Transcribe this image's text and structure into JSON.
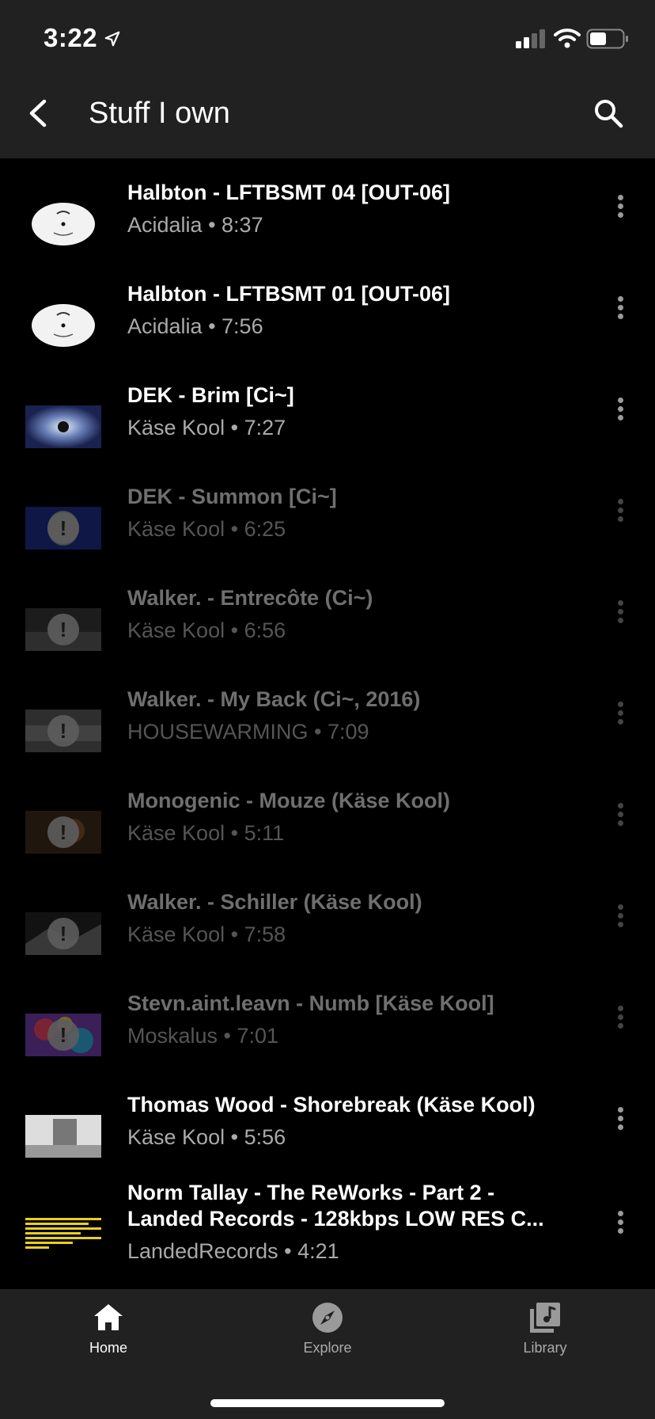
{
  "status": {
    "time": "3:22"
  },
  "header": {
    "title": "Stuff I own"
  },
  "items": [
    {
      "title": "Halbton - LFTBSMT 04 [OUT-06]",
      "channel": "Acidalia",
      "duration": "8:37",
      "unavailable": false
    },
    {
      "title": "Halbton - LFTBSMT 01 [OUT-06]",
      "channel": "Acidalia",
      "duration": "7:56",
      "unavailable": false
    },
    {
      "title": "DEK - Brim [Ci~]",
      "channel": "Käse Kool",
      "duration": "7:27",
      "unavailable": false
    },
    {
      "title": "DEK - Summon [Ci~]",
      "channel": "Käse Kool",
      "duration": "6:25",
      "unavailable": true
    },
    {
      "title": "Walker. - Entrecôte (Ci~)",
      "channel": "Käse Kool",
      "duration": "6:56",
      "unavailable": true
    },
    {
      "title": "Walker. - My Back (Ci~, 2016)",
      "channel": "HOUSEWARMING",
      "duration": "7:09",
      "unavailable": true
    },
    {
      "title": "Monogenic - Mouze (Käse Kool)",
      "channel": "Käse Kool",
      "duration": "5:11",
      "unavailable": true
    },
    {
      "title": "Walker. - Schiller (Käse Kool)",
      "channel": "Käse Kool",
      "duration": "7:58",
      "unavailable": true
    },
    {
      "title": "Stevn.aint.leavn - Numb [Käse Kool]",
      "channel": "Moskalus",
      "duration": "7:01",
      "unavailable": true
    },
    {
      "title": "Thomas Wood - Shorebreak (Käse Kool)",
      "channel": "Käse Kool",
      "duration": "5:56",
      "unavailable": false
    },
    {
      "title": "Norm Tallay - The ReWorks - Part 2 - Landed Records - 128kbps LOW RES C...",
      "channel": "LandedRecords",
      "duration": "4:21",
      "unavailable": false
    }
  ],
  "nav": [
    {
      "label": "Home",
      "icon": "home-icon",
      "active": true
    },
    {
      "label": "Explore",
      "icon": "compass-icon",
      "active": false
    },
    {
      "label": "Library",
      "icon": "library-icon",
      "active": false
    }
  ]
}
